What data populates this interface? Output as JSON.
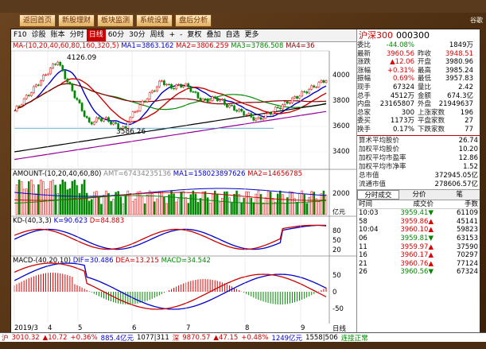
{
  "app": {
    "top_buttons": [
      "返回首页",
      "新股理财",
      "板块监测",
      "系统设置",
      "盘后分析"
    ],
    "corner": "谷歌"
  },
  "toolbar": {
    "items": [
      "F10",
      "诊股",
      "账本",
      "分时",
      "日线",
      "60分",
      "30分",
      "周线",
      "+",
      "-",
      "复权",
      "叠加",
      "自选",
      "更多"
    ],
    "selected": "日线"
  },
  "ma_legend": {
    "label": "MA-(10,20,40,60,80,160,320,5)",
    "ma1": "MA1=3863.162",
    "ma2": "MA2=3806.259",
    "ma3": "MA3=3786.508",
    "ma4": "MA4=36"
  },
  "price_chart": {
    "high_label": "4126.09",
    "low_label": "3586.26",
    "yticks": [
      "4000",
      "3800",
      "3600",
      "3400"
    ]
  },
  "amount": {
    "label": "AMOUNT-(10,20,40,60,80)",
    "amt": "AMT=67434235136",
    "ma1": "MA1=158023897626",
    "ma2": "MA2=14656785",
    "ytick": "2000",
    "unit": "亿元"
  },
  "kd": {
    "label": "KD-(40,3,3)",
    "k": "K=90.623",
    "d": "D=84.883",
    "yticks": [
      "80",
      "50",
      "20"
    ]
  },
  "macd": {
    "label": "MACD-(40,20,10)",
    "dif": "DIF=30.486",
    "dea": "DEA=13.215",
    "macd": "MACD=34.542",
    "yticks": [
      "50",
      "0",
      "-50"
    ]
  },
  "x_labels": [
    "2019/3",
    "4",
    "5",
    "6",
    "7",
    "8",
    "9"
  ],
  "x_unit": "日线",
  "bottom_tabs": [
    "常用",
    "指标",
    "关联理论",
    "模板",
    "管理",
    "4 1jsd",
    "AV",
    "BBI",
    "BP",
    "SDTX",
    "ATRPI",
    "ABC",
    "ZDCR",
    "指标一步"
  ],
  "bottom_tab_selected": "模板",
  "quote": {
    "name": "沪深300",
    "code": "000300",
    "rows": [
      [
        "委比",
        "-44.08%",
        "",
        "1849万"
      ],
      [
        "最新",
        "3960.56",
        "昨收",
        "3948.51"
      ],
      [
        "涨跌",
        "▲12.06",
        "开盘",
        "3980.96"
      ],
      [
        "涨幅",
        "+0.31%",
        "最高",
        "3985.24"
      ],
      [
        "振幅",
        "0.69%",
        "最低",
        "3957.83"
      ],
      [
        "现手",
        "67324",
        "量比",
        "2.42"
      ],
      [
        "总手",
        "4512万",
        "金额",
        "674.3亿"
      ],
      [
        "内盘",
        "23165807",
        "外盘",
        "21949637"
      ],
      [
        "总家",
        "300",
        "上涨家数",
        "196"
      ],
      [
        "委买",
        "1173万",
        "平盘家数",
        "27"
      ],
      [
        "换手",
        "0.17%",
        "下跌家数",
        "77"
      ]
    ],
    "list": [
      [
        "算术平均股价",
        "26.74"
      ],
      [
        "加权平均股价",
        "10.20"
      ],
      [
        "加权平均市盈率",
        "12.86"
      ],
      [
        "加权平均市净率",
        "1.52"
      ],
      [
        "总市值",
        "372945.05亿"
      ],
      [
        "流通市值",
        "278606.57亿"
      ]
    ],
    "tabs": [
      "分时成交",
      "分价",
      "笔"
    ],
    "trade_header": [
      "时间",
      "成交价",
      "手数"
    ],
    "trades": [
      [
        "10:03",
        "3959.41▼",
        "61109"
      ],
      [
        "58",
        "3959.86▲",
        "45141"
      ],
      [
        "10:04",
        "3960.10▲",
        "59823"
      ],
      [
        "06",
        "3959.81▼",
        "63153"
      ],
      [
        "11",
        "3959.97▲",
        "37590"
      ],
      [
        "16",
        "3960.17▲",
        "70297"
      ],
      [
        "21",
        "3960.76▲",
        "77124"
      ],
      [
        "26",
        "3960.56▼",
        "67324"
      ]
    ],
    "side_bottom": [
      "分笔",
      "分时",
      "短线"
    ]
  },
  "statusbar": {
    "items": [
      {
        "t": "沪",
        "c": "#c00"
      },
      {
        "t": "3010.32",
        "c": "#c00"
      },
      {
        "t": "▲10.72",
        "c": "#c00"
      },
      {
        "t": "+0.36%",
        "c": "#c00"
      },
      {
        "t": "885.4亿元",
        "c": "#00c"
      },
      {
        "t": "1077|311",
        "c": "#000"
      },
      {
        "t": "深",
        "c": "#c00"
      },
      {
        "t": "9870.57",
        "c": "#c00"
      },
      {
        "t": "▲47.15",
        "c": "#c00"
      },
      {
        "t": "+0.48%",
        "c": "#c00"
      },
      {
        "t": "1249亿元",
        "c": "#00c"
      },
      {
        "t": "1558|506",
        "c": "#000"
      },
      {
        "t": "连接正常",
        "c": "#080"
      }
    ]
  },
  "colors": {
    "up": "#d00",
    "down": "#080",
    "accent": "#c00"
  }
}
